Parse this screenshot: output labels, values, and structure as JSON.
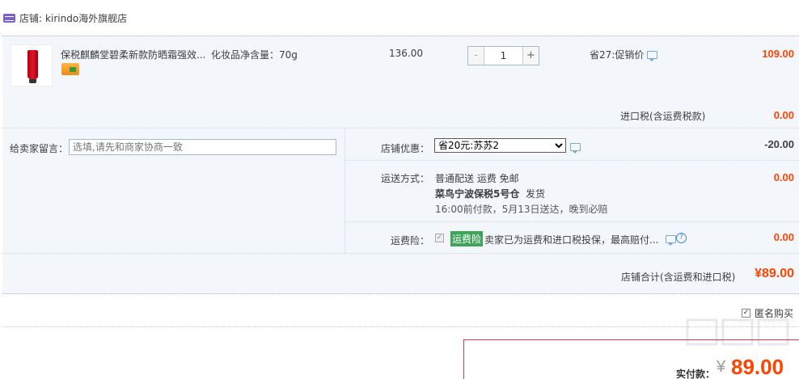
{
  "shop": {
    "label": "店铺:",
    "name": "kirindo海外旗舰店"
  },
  "item": {
    "title": "保税麒麟堂碧柔新款防晒霜强效...",
    "sku": "化妆品净含量：70g",
    "unit_price": "136.00",
    "quantity": "1",
    "minus": "-",
    "plus": "+",
    "discount": "省27:促销价",
    "price": "109.00"
  },
  "tax": {
    "label": "进口税(含运费税款)",
    "amount": "0.00"
  },
  "message": {
    "label": "给卖家留言：",
    "placeholder": "选填,请先和商家协商一致"
  },
  "promo": {
    "label": "店铺优惠：",
    "selected": "省20元:苏苏2",
    "amount": "-20.00"
  },
  "shipping": {
    "label": "运送方式：",
    "method": "普通配送 运费 免邮",
    "warehouse": "菜鸟宁波保税5号仓",
    "dispatch": "发货",
    "eta": "16:00前付款，5月13日送达，晚到必赔",
    "amount": "0.00"
  },
  "insurance": {
    "label": "运费险：",
    "tag": "运费险",
    "text": "卖家已为运费和进口税投保，最高赔付...",
    "help": "?",
    "amount": "0.00"
  },
  "subtotal": {
    "label": "店铺合计(含运费和进口税)",
    "amount": "¥89.00"
  },
  "anonymous": {
    "label": "匿名购买",
    "checked": true
  },
  "payment": {
    "label": "实付款：",
    "currency": "¥",
    "amount": "89.00"
  },
  "colors": {
    "price_red": "#ff4400",
    "box_bg": "#f3f7fc",
    "pay_border": "#e6334a",
    "tag_green": "#3fa35a"
  }
}
